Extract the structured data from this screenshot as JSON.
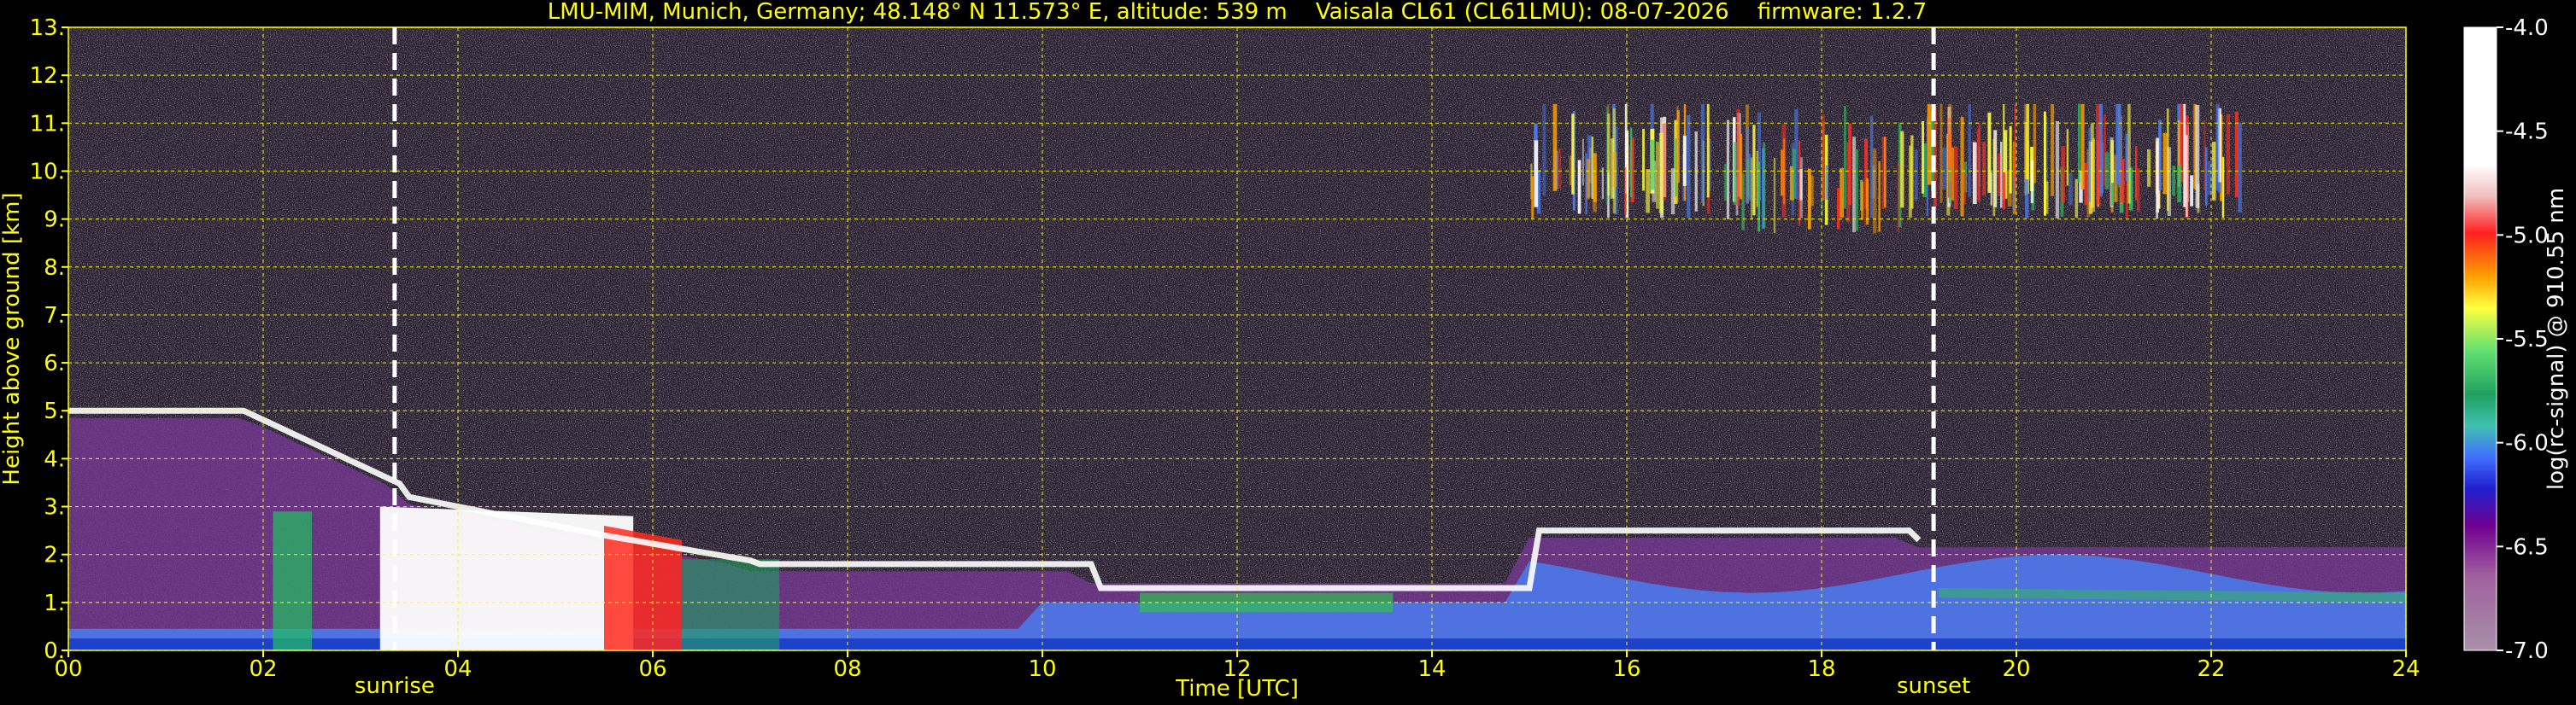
{
  "chart_data": {
    "type": "heatmap",
    "title": "LMU-MIM, Munich, Germany; 48.148° N 11.573° E, altitude: 539 m    Vaisala CL61 (CL61LMU): 08-07-2026    firmware: 1.2.7",
    "xlabel": "Time [UTC]",
    "ylabel": "Height above ground [km]",
    "xlim": [
      0,
      24
    ],
    "ylim": [
      0,
      13
    ],
    "x_ticks": [
      "00",
      "02",
      "04",
      "06",
      "08",
      "10",
      "12",
      "14",
      "16",
      "18",
      "20",
      "22",
      "24"
    ],
    "y_ticks": [
      "0.",
      "1.",
      "2.",
      "3.",
      "4.",
      "5.",
      "6.",
      "7.",
      "8.",
      "9.",
      "10.",
      "11.",
      "12.",
      "13."
    ],
    "grid": true,
    "grid_color": "#ffff00",
    "text_color": "#ffff00",
    "colorbar": {
      "label": "log(rc-signal) @ 910.55 nm",
      "range": [
        -7.0,
        -4.0
      ],
      "ticks": [
        "-4.0",
        "-4.5",
        "-5.0",
        "-5.5",
        "-6.0",
        "-6.5",
        "-7.0"
      ]
    },
    "events": [
      {
        "label": "sunrise",
        "time": 3.35
      },
      {
        "label": "sunset",
        "time": 19.15
      }
    ]
  }
}
